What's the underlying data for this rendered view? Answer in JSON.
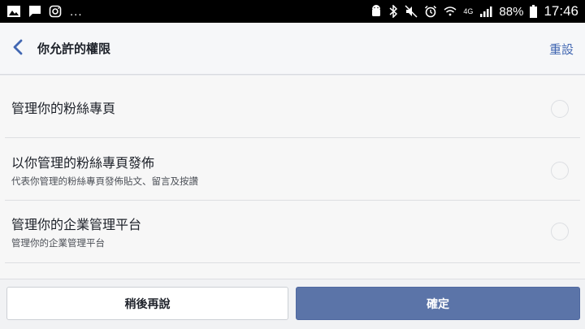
{
  "status_bar": {
    "left_icons": [
      "image-icon",
      "chat-icon",
      "instagram-icon"
    ],
    "overflow": "...",
    "network": "4G",
    "battery": "88%",
    "time": "17:46"
  },
  "header": {
    "title": "你允許的權限",
    "reset_label": "重設"
  },
  "permissions": [
    {
      "title": "管理你的粉絲專頁",
      "description": ""
    },
    {
      "title": "以你管理的粉絲專頁發佈",
      "description": "代表你管理的粉絲專頁發佈貼文、留言及按讚"
    },
    {
      "title": "管理你的企業管理平台",
      "description": "管理你的企業管理平台"
    }
  ],
  "footer": {
    "later_label": "稍後再說",
    "confirm_label": "確定"
  },
  "colors": {
    "accent": "#4267b2",
    "confirm_button": "#5b74a8"
  }
}
